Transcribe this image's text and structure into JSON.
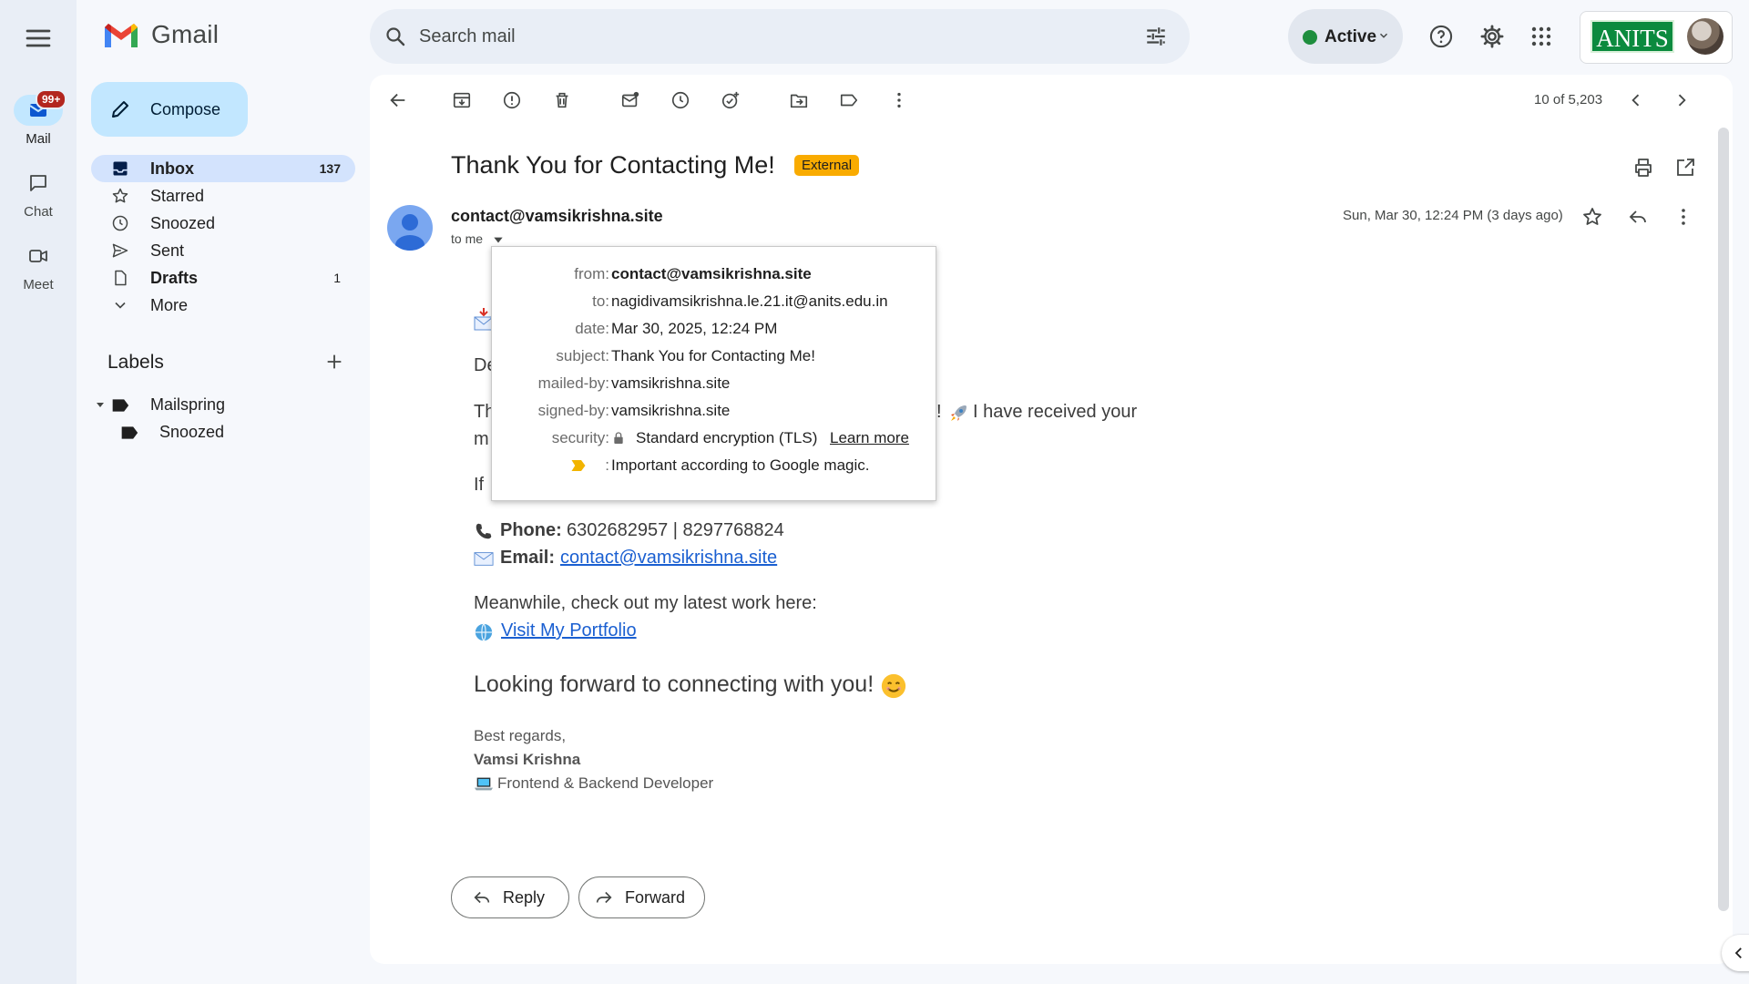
{
  "app": {
    "name": "Gmail"
  },
  "rail": {
    "mail_label": "Mail",
    "mail_badge": "99+",
    "chat_label": "Chat",
    "meet_label": "Meet"
  },
  "search": {
    "placeholder": "Search mail"
  },
  "status": {
    "label": "Active",
    "color": "#1e8e3e"
  },
  "org_logo": "ANITS",
  "compose": {
    "label": "Compose"
  },
  "nav": [
    {
      "label": "Inbox",
      "count": "137",
      "icon": "inbox-icon",
      "bold": true,
      "selected": true
    },
    {
      "label": "Starred",
      "count": "",
      "icon": "star-icon",
      "bold": false
    },
    {
      "label": "Snoozed",
      "count": "",
      "icon": "clock-icon",
      "bold": false
    },
    {
      "label": "Sent",
      "count": "",
      "icon": "send-icon",
      "bold": false
    },
    {
      "label": "Drafts",
      "count": "1",
      "icon": "draft-icon",
      "bold": true
    },
    {
      "label": "More",
      "count": "",
      "icon": "chevron-down-icon",
      "bold": false
    }
  ],
  "labels": {
    "heading": "Labels",
    "items": [
      {
        "label": "Mailspring"
      },
      {
        "label": "Snoozed"
      }
    ]
  },
  "toolbar": {
    "counter": "10 of 5,203"
  },
  "email": {
    "subject": "Thank You for Contacting Me!",
    "tag": "External",
    "sender": "contact@vamsikrishna.site",
    "to_line": "to me",
    "date": "Sun, Mar 30, 12:24 PM (3 days ago)",
    "body": {
      "greeting_fragment": "De",
      "line1_start": "Th",
      "line1_end": "I have received your",
      "line2_start": "m",
      "line3_start": "If",
      "phone_label": "Phone:",
      "phone_value": "6302682957 | 8297768824",
      "email_label": "Email:",
      "email_value": "contact@vamsikrishna.site",
      "meanwhile": "Meanwhile, check out my latest work here:",
      "portfolio_link": "Visit My Portfolio",
      "closing": "Looking forward to connecting with you!",
      "regards": "Best regards,",
      "name": "Vamsi Krishna",
      "role": "Frontend & Backend Developer"
    }
  },
  "details_popover": {
    "from_key": "from:",
    "from_val": "contact@vamsikrishna.site",
    "to_key": "to:",
    "to_val": "nagidivamsikrishna.le.21.it@anits.edu.in",
    "date_key": "date:",
    "date_val": "Mar 30, 2025, 12:24 PM",
    "subject_key": "subject:",
    "subject_val": "Thank You for Contacting Me!",
    "mailed_key": "mailed-by:",
    "mailed_val": "vamsikrishna.site",
    "signed_key": "signed-by:",
    "signed_val": "vamsikrishna.site",
    "security_key": "security:",
    "security_val": "Standard encryption (TLS)",
    "learn_more": "Learn more",
    "important_key": ":",
    "important_val": "Important according to Google magic."
  },
  "actions": {
    "reply": "Reply",
    "forward": "Forward"
  }
}
